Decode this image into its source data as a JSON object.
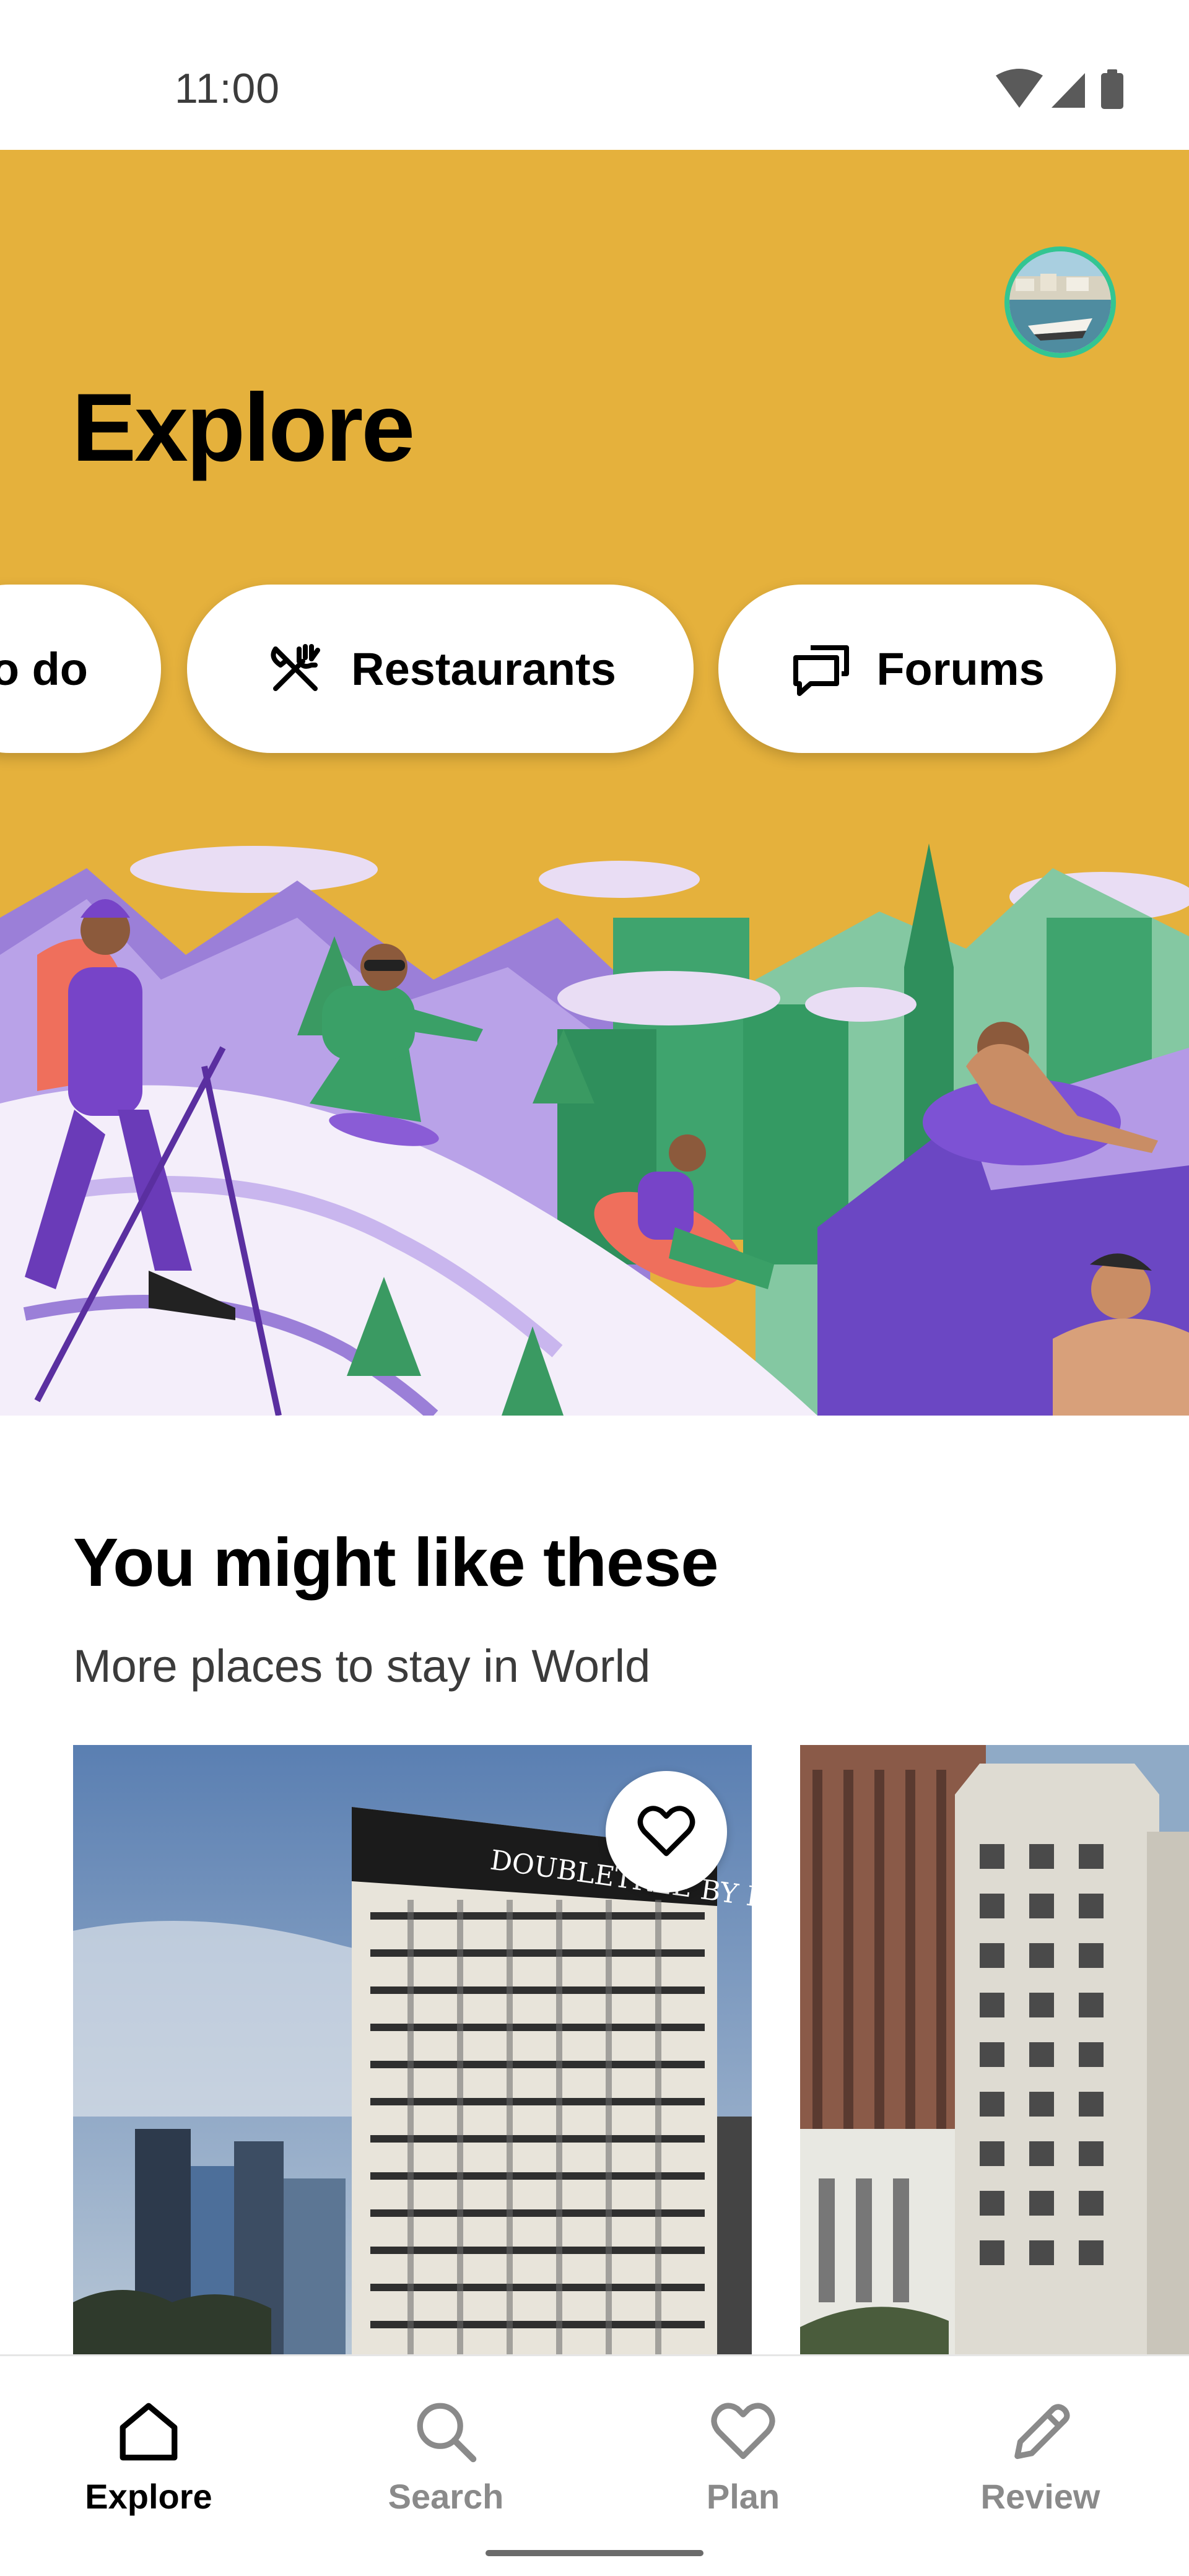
{
  "status_bar": {
    "time": "11:00",
    "icons": [
      "wifi-icon",
      "cellular-signal-icon",
      "battery-icon"
    ]
  },
  "header": {
    "title": "Explore",
    "profile_avatar": "profile-avatar"
  },
  "category_chips": [
    {
      "label": "o do",
      "icon": "none"
    },
    {
      "label": "Restaurants",
      "icon": "fork-knife-icon"
    },
    {
      "label": "Forums",
      "icon": "chat-bubbles-icon"
    }
  ],
  "section": {
    "title": "You might like these",
    "subtitle": "More places to stay in World",
    "cards": [
      {
        "image": "hotel-photo-doubletree",
        "sign_text": "DOUBLETREE BY HILTON",
        "saved": false,
        "save_icon": "heart-outline-icon"
      },
      {
        "image": "hotel-photo-historic-building"
      }
    ]
  },
  "bottom_nav": {
    "items": [
      {
        "label": "Explore",
        "icon": "home-icon",
        "active": true
      },
      {
        "label": "Search",
        "icon": "search-icon",
        "active": false
      },
      {
        "label": "Plan",
        "icon": "heart-icon",
        "active": false
      },
      {
        "label": "Review",
        "icon": "pencil-icon",
        "active": false
      }
    ]
  },
  "colors": {
    "hero_background": "#e5b13c",
    "accent_green": "#34e0a1",
    "inactive_nav": "#8a8a8a",
    "text_primary": "#000000"
  }
}
